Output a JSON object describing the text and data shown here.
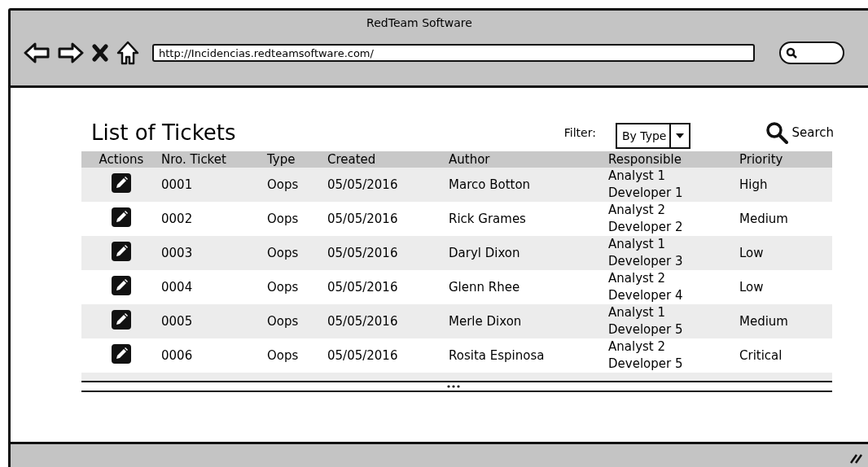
{
  "window": {
    "title": "RedTeam Software"
  },
  "browser": {
    "url": "http://Incidencias.redteamsoftware.com/"
  },
  "page": {
    "heading": "List of Tickets",
    "filter": {
      "label": "Filter:",
      "value": "By Type"
    },
    "search": "Search"
  },
  "table": {
    "columns": [
      "Actions",
      "Nro. Ticket",
      "Type",
      "Created",
      "Author",
      "Responsible",
      "Priority"
    ],
    "rows": [
      {
        "ticket": "0001",
        "type": "Oops",
        "created": "05/05/2016",
        "author": "Marco Botton",
        "responsible": "Analyst 1\nDeveloper 1",
        "priority": "High"
      },
      {
        "ticket": "0002",
        "type": "Oops",
        "created": "05/05/2016",
        "author": "Rick Grames",
        "responsible": "Analyst 2\nDeveloper 2",
        "priority": "Medium"
      },
      {
        "ticket": "0003",
        "type": "Oops",
        "created": "05/05/2016",
        "author": "Daryl Dixon",
        "responsible": "Analyst 1\nDeveloper 3",
        "priority": "Low"
      },
      {
        "ticket": "0004",
        "type": "Oops",
        "created": "05/05/2016",
        "author": "Glenn Rhee",
        "responsible": "Analyst 2\nDeveloper 4",
        "priority": "Low"
      },
      {
        "ticket": "0005",
        "type": "Oops",
        "created": "05/05/2016",
        "author": "Merle Dixon",
        "responsible": "Analyst 1\nDeveloper 5",
        "priority": "Medium"
      },
      {
        "ticket": "0006",
        "type": "Oops",
        "created": "05/05/2016",
        "author": "Rosita Espinosa",
        "responsible": "Analyst 2\nDeveloper 5",
        "priority": "Critical"
      }
    ]
  }
}
